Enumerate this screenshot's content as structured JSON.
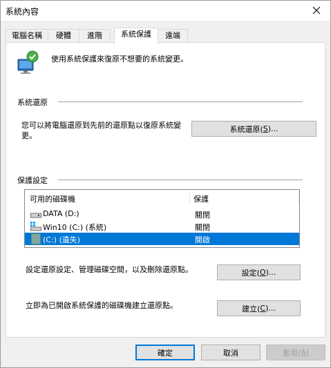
{
  "window": {
    "title": "系統內容",
    "close_glyph": "✕"
  },
  "tabs": [
    {
      "label": "電腦名稱",
      "active": false
    },
    {
      "label": "硬體",
      "active": false
    },
    {
      "label": "進階",
      "active": false
    },
    {
      "label": "系統保護",
      "active": true
    },
    {
      "label": "遠端",
      "active": false
    }
  ],
  "header": {
    "description": "使用系統保護來復原不想要的系統變更。",
    "icon": "system-protection-shield-monitor-icon"
  },
  "restore": {
    "group_label": "系統還原",
    "description": "您可以將電腦還原到先前的還原點以復原系統變更。",
    "button": {
      "text": "系統還原(",
      "mnemonic": "S",
      "suffix": ")..."
    }
  },
  "protection": {
    "group_label": "保護設定",
    "columns": [
      "可用的磁碟機",
      "保護"
    ],
    "drives": [
      {
        "name": "DATA (D:)",
        "status": "關閉",
        "icon": "hard-drive-icon",
        "selected": false
      },
      {
        "name": "Win10 (C:) (系統)",
        "status": "關閉",
        "icon": "windows-drive-icon",
        "selected": false
      },
      {
        "name": "(C:) (遺失)",
        "status": "開啟",
        "icon": "missing-drive-icon",
        "selected": true
      }
    ],
    "configure_text": "設定還原設定、管理磁碟空間，以及刪除還原點。",
    "configure_button": {
      "text": "設定(",
      "mnemonic": "O",
      "suffix": ")..."
    },
    "create_text": "立即為已開啟系統保護的磁碟機建立還原點。",
    "create_button": {
      "text": "建立(",
      "mnemonic": "C",
      "suffix": ")..."
    }
  },
  "footer": {
    "ok": "確定",
    "cancel": "取消",
    "apply": {
      "text": "套用(",
      "mnemonic": "A",
      "suffix": ")"
    }
  },
  "colors": {
    "accent": "#0078d7",
    "panel": "#ffffff",
    "chrome": "#f0f0f0"
  }
}
